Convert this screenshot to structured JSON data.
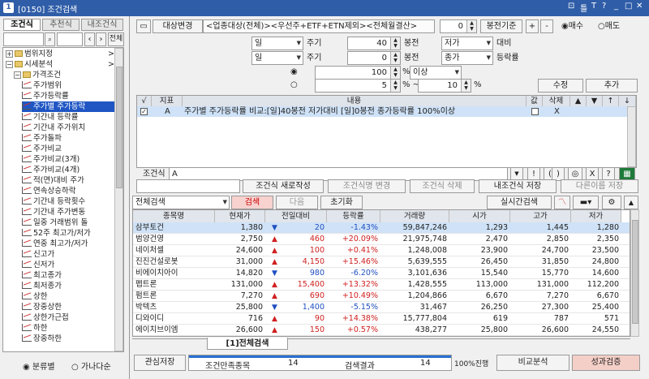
{
  "window": {
    "badge": "1",
    "title": "[0150] 조건검색",
    "controls": [
      "⊡",
      "틀",
      "T",
      "?",
      "_",
      "□",
      "✕"
    ]
  },
  "left": {
    "tabs": [
      "조건식",
      "추천식",
      "내조건식"
    ],
    "search_button": "전체",
    "tree": [
      {
        "label": "범위지정",
        "level": 0,
        "kind": "folder-closed"
      },
      {
        "label": "시세분석",
        "level": 0,
        "kind": "folder-open"
      },
      {
        "label": "가격조건",
        "level": 1,
        "kind": "folder-open"
      },
      {
        "label": "주가범위",
        "level": 2,
        "kind": "item"
      },
      {
        "label": "주가등락률",
        "level": 2,
        "kind": "item"
      },
      {
        "label": "주가별 주가등락",
        "level": 2,
        "kind": "item",
        "selected": true
      },
      {
        "label": "기간내 등락률",
        "level": 2,
        "kind": "item"
      },
      {
        "label": "기간내 주가위치",
        "level": 2,
        "kind": "item"
      },
      {
        "label": "주가돌파",
        "level": 2,
        "kind": "item"
      },
      {
        "label": "주가비교",
        "level": 2,
        "kind": "item"
      },
      {
        "label": "주가비교(3개)",
        "level": 2,
        "kind": "item"
      },
      {
        "label": "주가비교(4개)",
        "level": 2,
        "kind": "item"
      },
      {
        "label": "적(면)대비 주가",
        "level": 2,
        "kind": "item"
      },
      {
        "label": "연속상승하락",
        "level": 2,
        "kind": "item"
      },
      {
        "label": "기간내 등락횟수",
        "level": 2,
        "kind": "item"
      },
      {
        "label": "기간내 주가변동",
        "level": 2,
        "kind": "item"
      },
      {
        "label": "일중 거래범위 돌",
        "level": 2,
        "kind": "item"
      },
      {
        "label": "52주 최고가/저가",
        "level": 2,
        "kind": "item"
      },
      {
        "label": "연중 최고가/저가",
        "level": 2,
        "kind": "item"
      },
      {
        "label": "신고가",
        "level": 2,
        "kind": "item"
      },
      {
        "label": "신저가",
        "level": 2,
        "kind": "item"
      },
      {
        "label": "최고종가",
        "level": 2,
        "kind": "item"
      },
      {
        "label": "최저종가",
        "level": 2,
        "kind": "item"
      },
      {
        "label": "상한",
        "level": 2,
        "kind": "item"
      },
      {
        "label": "장중상한",
        "level": 2,
        "kind": "item"
      },
      {
        "label": "상한가근접",
        "level": 2,
        "kind": "item"
      },
      {
        "label": "하한",
        "level": 2,
        "kind": "item"
      },
      {
        "label": "장중하한",
        "level": 2,
        "kind": "item"
      }
    ],
    "radio": {
      "options": [
        "분류별",
        "가나다순"
      ],
      "selected": "분류별"
    }
  },
  "top": {
    "target_button": "대상변경",
    "target_text": "<업종대상(전체)><우선주+ETF+ETN제외><전체월결산>",
    "bong_value": "0",
    "bong_button": "봉전기준",
    "plus": "+",
    "minus": "-",
    "trade": {
      "options": [
        "매수",
        "매도"
      ],
      "selected": "매수"
    },
    "row1": {
      "period": "일",
      "period_label": "주기",
      "n": "40",
      "n_label": "봉전",
      "price": "저가",
      "price_label": "대비"
    },
    "row2": {
      "period": "일",
      "period_label": "주기",
      "n": "0",
      "n_label": "봉전",
      "price": "종가",
      "price_label": "등락률"
    },
    "row3": {
      "value": "100",
      "unit": "%",
      "op": "이상"
    },
    "row4": {
      "from": "5",
      "unit1": "% ~",
      "to": "10",
      "unit2": "%"
    },
    "edit_button": "수정",
    "add_button": "추가"
  },
  "cond": {
    "headers": [
      "√",
      "지표",
      "내용",
      "값",
      "삭제",
      "▲",
      "▼",
      "↑",
      "↓"
    ],
    "rows": [
      {
        "checked": true,
        "indicator": "A",
        "content": "주가별 주가등락률 비교:[일]40봉전 저가대비 [일]0봉전 종가등락률 100%이상",
        "value_checked": false,
        "delete": "X"
      }
    ],
    "formula_label": "조건식",
    "formula": "A",
    "ops": [
      "▼",
      "!",
      "(",
      ")",
      "◎",
      "X",
      "?"
    ]
  },
  "actions": {
    "buttons": [
      "조건식 새로작성",
      "조건식명 변경",
      "조건식 삭제",
      "내조건식 저장",
      "다른이름 저장"
    ]
  },
  "search": {
    "target": "전체검색",
    "search_button": "검색",
    "next_button": "다음",
    "reset_button": "초기화",
    "realtime_button": "실시간검색"
  },
  "grid": {
    "headers": [
      "종목명",
      "현재가",
      "전일대비",
      "등락률",
      "거래량",
      "시가",
      "고가",
      "저가"
    ],
    "rows": [
      {
        "name": "삼부토건",
        "price": "1,380",
        "dir": "dn",
        "chg": "20",
        "rate": "-1.43%",
        "vol": "59,847,246",
        "open": "1,293",
        "high": "1,445",
        "low": "1,280"
      },
      {
        "name": "범양건영",
        "price": "2,750",
        "dir": "up",
        "chg": "460",
        "rate": "+20.09%",
        "vol": "21,975,748",
        "open": "2,470",
        "high": "2,850",
        "low": "2,350"
      },
      {
        "name": "네이처셀",
        "price": "24,600",
        "dir": "up",
        "chg": "100",
        "rate": "+0.41%",
        "vol": "1,248,008",
        "open": "23,900",
        "high": "24,700",
        "low": "23,500"
      },
      {
        "name": "진진건설로봇",
        "price": "31,000",
        "dir": "up",
        "chg": "4,150",
        "rate": "+15.46%",
        "vol": "5,639,555",
        "open": "26,450",
        "high": "31,850",
        "low": "24,800"
      },
      {
        "name": "비에이치아이",
        "price": "14,820",
        "dir": "dn",
        "chg": "980",
        "rate": "-6.20%",
        "vol": "3,101,636",
        "open": "15,540",
        "high": "15,770",
        "low": "14,600"
      },
      {
        "name": "펩트론",
        "price": "131,000",
        "dir": "up",
        "chg": "15,400",
        "rate": "+13.32%",
        "vol": "1,428,555",
        "open": "113,000",
        "high": "131,000",
        "low": "112,200"
      },
      {
        "name": "펌트론",
        "price": "7,270",
        "dir": "up",
        "chg": "690",
        "rate": "+10.49%",
        "vol": "1,204,866",
        "open": "6,670",
        "high": "7,270",
        "low": "6,670"
      },
      {
        "name": "박텍츠",
        "price": "25,800",
        "dir": "dn",
        "chg": "1,400",
        "rate": "-5.15%",
        "vol": "31,467",
        "open": "26,250",
        "high": "27,300",
        "low": "25,400"
      },
      {
        "name": "디와이디",
        "price": "716",
        "dir": "up",
        "chg": "90",
        "rate": "+14.38%",
        "vol": "15,777,804",
        "open": "619",
        "high": "787",
        "low": "571"
      },
      {
        "name": "에이치브이엠",
        "price": "26,600",
        "dir": "up",
        "chg": "150",
        "rate": "+0.57%",
        "vol": "438,277",
        "open": "25,800",
        "high": "26,600",
        "low": "24,550"
      }
    ]
  },
  "bottom_tab": "[1]전체검색",
  "status": {
    "interest_button": "관심저장",
    "match_label": "조건만족종목",
    "match_value": "14",
    "result_label": "검색결과",
    "result_value": "14",
    "progress_text": "100%진행",
    "progress": 1.0,
    "compare_button": "비교분석",
    "verify_button": "성과검증"
  },
  "colors": {
    "title_bg": "#2f5da8",
    "up": "#d02020",
    "down": "#1f4fc0",
    "selected_row": "#cfe2f7",
    "verify_bg": "#f4cfc7",
    "search_bg": "#f7d2cf"
  }
}
